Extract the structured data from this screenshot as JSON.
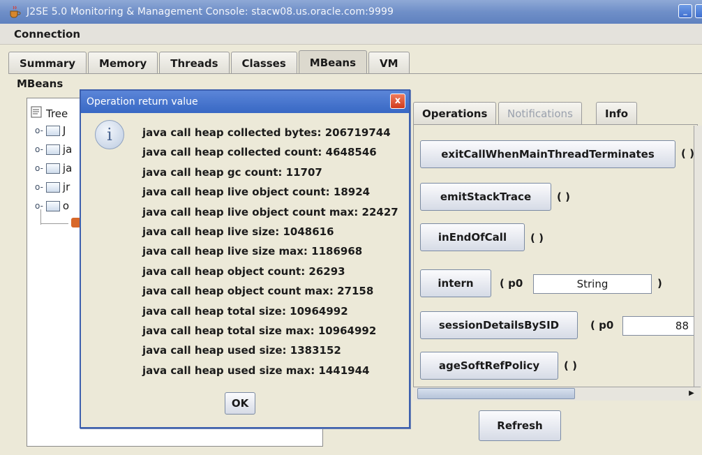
{
  "window": {
    "title": "J2SE 5.0 Monitoring & Management Console: stacw08.us.oracle.com:9999"
  },
  "menu": {
    "items": [
      "Connection"
    ]
  },
  "tabs": [
    "Summary",
    "Memory",
    "Threads",
    "Classes",
    "MBeans",
    "VM"
  ],
  "active_tab": "MBeans",
  "mbeans": {
    "section_label": "MBeans",
    "tree_root_label": "Tree",
    "tree_rows": [
      "J",
      "ja",
      "ja",
      "jr",
      "o"
    ]
  },
  "right_tabs": [
    "Operations",
    "Notifications",
    "Info"
  ],
  "operations": [
    {
      "name": "exitCallWhenMainThreadTerminates",
      "params": "( )"
    },
    {
      "name": "emitStackTrace",
      "params": "( )"
    },
    {
      "name": "inEndOfCall",
      "params": "( )"
    },
    {
      "name": "intern",
      "param_label": "( p0",
      "param_value": "String",
      "param_close": ")"
    },
    {
      "name": "sessionDetailsBySID",
      "param_label": "( p0",
      "param_value": "88"
    },
    {
      "name": "ageSoftRefPolicy",
      "params": "( )"
    }
  ],
  "refresh_label": "Refresh",
  "dialog": {
    "title": "Operation return value",
    "close_label": "x",
    "lines": [
      "java call heap collected bytes: 206719744",
      "java call heap collected count: 4648546",
      "java call heap gc count: 11707",
      "java call heap live object count: 18924",
      "java call heap live object count max: 22427",
      "java call heap live size: 1048616",
      "java call heap live size max: 1186968",
      "java call heap object count: 26293",
      "java call heap object count max: 27158",
      "java call heap total size: 10964992",
      "java call heap total size max: 10964992",
      "java call heap used size: 1383152",
      "java call heap used size max: 1441944"
    ],
    "ok_label": "OK"
  }
}
